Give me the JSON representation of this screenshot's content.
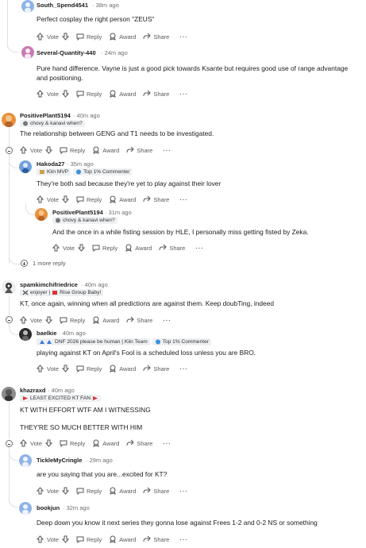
{
  "icons": {
    "upvote": "upvote-arrow-icon",
    "downvote": "downvote-arrow-icon",
    "reply": "speech-bubble-icon",
    "award": "award-ribbon-icon",
    "share": "share-arrow-icon",
    "more": "ellipsis-icon"
  },
  "actions": {
    "vote": "Vote",
    "reply": "Reply",
    "award": "Award",
    "share": "Share",
    "more": "···"
  },
  "more_replies": "1 more reply",
  "comments": {
    "c1": {
      "user": "South_Spend4541",
      "time": "· 38m ago",
      "body": [
        "Perfect cosplay the right person \"ZEUS\""
      ]
    },
    "c2": {
      "user": "Several-Quantity-440",
      "time": "· 24m ago",
      "body": [
        "Pure hand difference. Vayne is just a good pick towards Ksante but requires good use of range advantage",
        "and positioning."
      ]
    },
    "c3": {
      "user": "PositivePlant5194",
      "time": "· 40m ago",
      "flair": "chovy & kanavi when?",
      "body": [
        "The relationship between GENG and T1 needs to be investigated."
      ]
    },
    "c4": {
      "user": "Hakoda27",
      "time": "· 35m ago",
      "flair1": "Kiin MVP",
      "flair2": "Top 1% Commenter",
      "body": [
        "They're both sad because they're yet to play against their lover"
      ]
    },
    "c5": {
      "user": "PositivePlant5194",
      "time": "· 31m ago",
      "flair": "chovy & kanavi when?",
      "body": [
        "And the once in a while fisting session by HLE, I personally miss getting fisted by Zeka."
      ]
    },
    "c6": {
      "user": "spamkimchifriedrice",
      "time": "· 40m ago",
      "flair1": "enjoyer |",
      "flair2": "Rise Group Baby!",
      "body": [
        "KT, once again, winning when all predictions are against them. Keep doubTing, indeed"
      ]
    },
    "c7": {
      "user": "baelkie",
      "time": "· 40m ago",
      "flair1": "DNF 2026 please be human | Kiin Team",
      "flair2": "Top 1% Commenter",
      "body": [
        "playing against KT on April's Fool is a scheduled loss unless you are BRO."
      ]
    },
    "c8": {
      "user": "khazraxd",
      "time": "· 40m ago",
      "flair": "LEAST EXCITED KT FAN",
      "body": [
        "KT WITH EFFORT WTF AM I WITNESSING",
        "THEY'RE SO MUCH BETTER WITH HIM"
      ]
    },
    "c9": {
      "user": "TickleMyCringle",
      "time": "· 29m ago",
      "body": [
        "are you saying that you are...excited for KT?"
      ]
    },
    "c10": {
      "user": "bookjun",
      "time": "· 32m ago",
      "body": [
        "Deep down you know it next series they gonna lose against Frees 1-2 and 0-2 NS or something"
      ]
    }
  },
  "colors": {
    "avatar_orange": "#e8903a",
    "avatar_blue": "#6fa0e0",
    "avatar_pink": "#c87bb0",
    "avatar_dark": "#2b2b2b",
    "avatar_gray": "#8c8c8c",
    "thread_line": "#dfe1e3"
  }
}
